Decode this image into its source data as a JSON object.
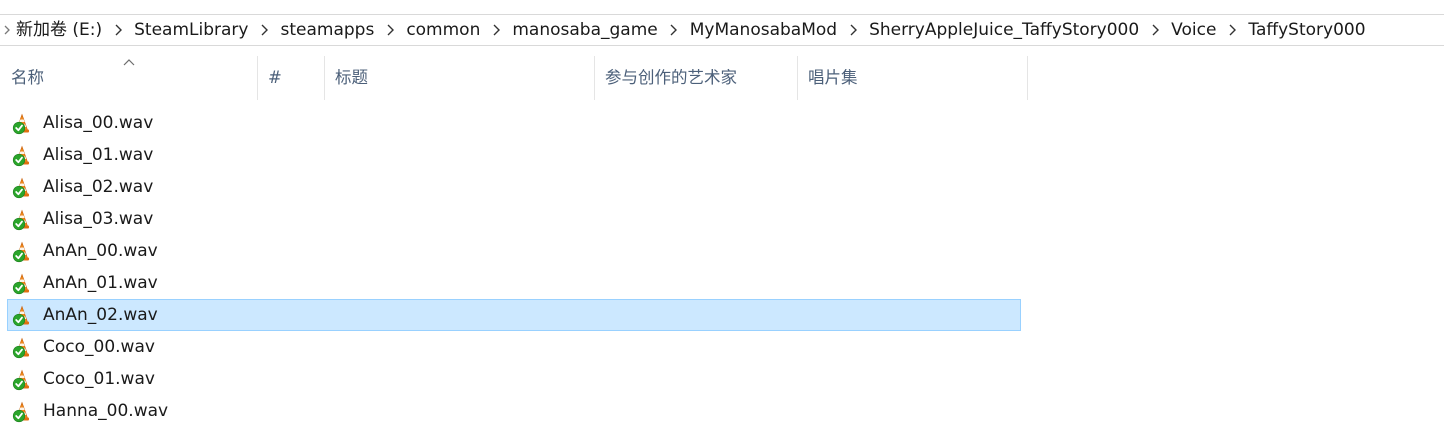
{
  "breadcrumb": [
    "新加卷 (E:)",
    "SteamLibrary",
    "steamapps",
    "common",
    "manosaba_game",
    "MyManosabaMod",
    "SherryAppleJuice_TaffyStory000",
    "Voice",
    "TaffyStory000"
  ],
  "columns": {
    "name": "名称",
    "number": "#",
    "title": "标题",
    "artist": "参与创作的艺术家",
    "album": "唱片集"
  },
  "sort": {
    "column": "name",
    "direction": "ascending"
  },
  "files": [
    {
      "name": "Alisa_00.wav",
      "icon": "vlc-media-file-icon",
      "selected": false
    },
    {
      "name": "Alisa_01.wav",
      "icon": "vlc-media-file-icon",
      "selected": false
    },
    {
      "name": "Alisa_02.wav",
      "icon": "vlc-media-file-icon",
      "selected": false
    },
    {
      "name": "Alisa_03.wav",
      "icon": "vlc-media-file-icon",
      "selected": false
    },
    {
      "name": "AnAn_00.wav",
      "icon": "vlc-media-file-icon",
      "selected": false
    },
    {
      "name": "AnAn_01.wav",
      "icon": "vlc-media-file-icon",
      "selected": false
    },
    {
      "name": "AnAn_02.wav",
      "icon": "vlc-media-file-icon",
      "selected": true
    },
    {
      "name": "Coco_00.wav",
      "icon": "vlc-media-file-icon",
      "selected": false
    },
    {
      "name": "Coco_01.wav",
      "icon": "vlc-media-file-icon",
      "selected": false
    },
    {
      "name": "Hanna_00.wav",
      "icon": "vlc-media-file-icon",
      "selected": false
    }
  ],
  "colors": {
    "selection_bg": "#cce8ff",
    "selection_border": "#99d1ff",
    "header_text": "#4c607a"
  }
}
